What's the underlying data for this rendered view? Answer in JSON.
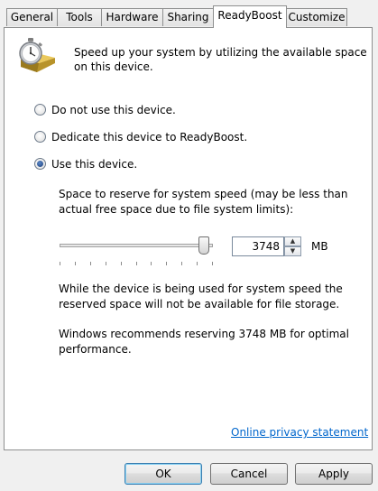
{
  "tabs": [
    {
      "label": "General",
      "active": false
    },
    {
      "label": "Tools",
      "active": false
    },
    {
      "label": "Hardware",
      "active": false
    },
    {
      "label": "Sharing",
      "active": false
    },
    {
      "label": "ReadyBoost",
      "active": true
    },
    {
      "label": "Customize",
      "active": false
    }
  ],
  "header": {
    "icon": "readyboost-stopwatch-icon",
    "description": [
      "Speed up your system by utilizing the available space",
      "on this device."
    ]
  },
  "options": [
    {
      "label": "Do not use this device.",
      "selected": false
    },
    {
      "label": "Dedicate this device to ReadyBoost.",
      "selected": false
    },
    {
      "label": "Use this device.",
      "selected": true
    }
  ],
  "reserve": {
    "label": [
      "Space to reserve for system speed (may be less than",
      "actual free space due to file system limits):"
    ],
    "value": "3748",
    "unit": "MB",
    "slider_fraction": 0.94
  },
  "notes": {
    "usage": [
      "While the device is being used for system speed the",
      "reserved space will not be available for file storage."
    ],
    "recommend": [
      "Windows recommends reserving 3748 MB for optimal",
      "performance."
    ]
  },
  "privacy_link": "Online privacy statement",
  "buttons": {
    "ok": "OK",
    "cancel": "Cancel",
    "apply": "Apply"
  },
  "colors": {
    "link": "#0066cc",
    "default_button_border": "#3c7fb1"
  }
}
